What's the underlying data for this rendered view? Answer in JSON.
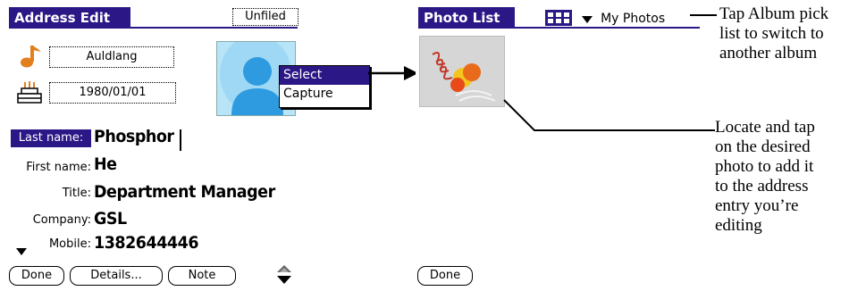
{
  "colors": {
    "header": "#2b1785",
    "accent": "#e2801f",
    "photo_frame": "#d6d6d6"
  },
  "address_edit": {
    "title": "Address Edit",
    "category": "Unfiled",
    "ringtone": "Auldlang",
    "birthday": "1980/01/01",
    "photo_menu": [
      "Select",
      "Capture"
    ],
    "fields": [
      {
        "label": "Last name:",
        "value": "Phosphor",
        "selected": true
      },
      {
        "label": "First name:",
        "value": "He"
      },
      {
        "label": "Title:",
        "value": "Department Manager"
      },
      {
        "label": "Company:",
        "value": "GSL"
      },
      {
        "label": "Mobile:",
        "value": "1382644446"
      }
    ],
    "buttons": {
      "done": "Done",
      "details": "Details...",
      "note": "Note"
    },
    "icons": {
      "ringtone": "music-note-icon",
      "birthday": "birthday-cake-icon",
      "photo": "contact-silhouette-icon",
      "scroll": "scroll-arrows-icon"
    }
  },
  "photo_list": {
    "title": "Photo List",
    "album": "My Photos",
    "done_label": "Done",
    "icons": {
      "view": "thumbnail-grid-icon",
      "dropdown": "triangle-down-icon"
    }
  },
  "annotations": {
    "album_note": [
      "Tap Album pick",
      "list to switch to",
      "another album"
    ],
    "photo_note": [
      "Locate and tap",
      "on the desired",
      "photo to add it",
      "to the address",
      "entry you’re",
      "editing"
    ]
  }
}
